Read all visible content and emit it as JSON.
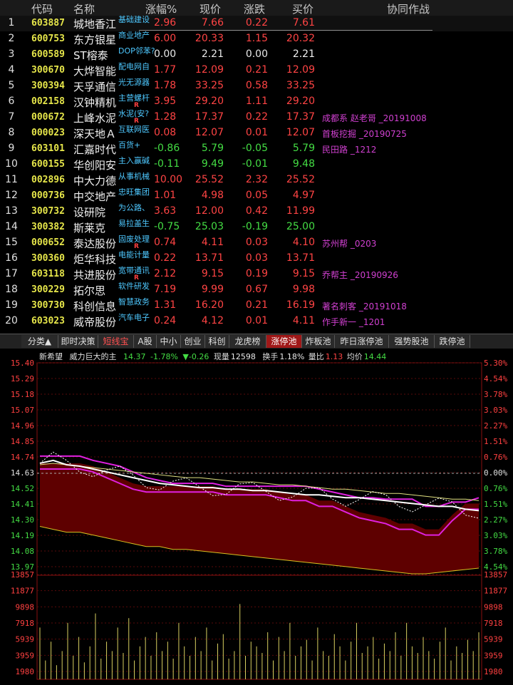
{
  "headers": {
    "idx": "",
    "code": "代码",
    "name": "名称",
    "pct": "涨幅%",
    "price": "现价",
    "chg": "涨跌",
    "bid": "买价",
    "note": "协同作战"
  },
  "rows": [
    {
      "idx": "1",
      "code": "603887",
      "name": "城地香江",
      "ind": "基础建设",
      "r": "",
      "pct": "2.96",
      "price": "7.66",
      "chg": "0.22",
      "bid": "7.61",
      "note": "",
      "dir": "up"
    },
    {
      "idx": "2",
      "code": "600753",
      "name": "东方银星",
      "ind": "商业地产",
      "r": "",
      "pct": "6.00",
      "price": "20.33",
      "chg": "1.15",
      "bid": "20.32",
      "note": "",
      "dir": "up"
    },
    {
      "idx": "3",
      "code": "600589",
      "name": "ST榕泰",
      "ind": "DOP邻苯?",
      "r": "",
      "pct": "0.00",
      "price": "2.21",
      "chg": "0.00",
      "bid": "2.21",
      "note": "",
      "dir": "eq"
    },
    {
      "idx": "4",
      "code": "300670",
      "name": "大烨智能",
      "ind": "配电网自",
      "r": "",
      "pct": "1.77",
      "price": "12.09",
      "chg": "0.21",
      "bid": "12.09",
      "note": "",
      "dir": "up"
    },
    {
      "idx": "5",
      "code": "300394",
      "name": "天孚通信",
      "ind": "光无源器",
      "r": "",
      "pct": "1.78",
      "price": "33.25",
      "chg": "0.58",
      "bid": "33.25",
      "note": "",
      "dir": "up"
    },
    {
      "idx": "6",
      "code": "002158",
      "name": "汉钟精机",
      "ind": "主营螺杆",
      "r": "R",
      "pct": "3.95",
      "price": "29.20",
      "chg": "1.11",
      "bid": "29.20",
      "note": "",
      "dir": "up"
    },
    {
      "idx": "7",
      "code": "000672",
      "name": "上峰水泥",
      "ind": "水泥(安?",
      "r": "R",
      "pct": "1.28",
      "price": "17.37",
      "chg": "0.22",
      "bid": "17.37",
      "note": "成都系  赵老哥  _20191008",
      "dir": "up"
    },
    {
      "idx": "8",
      "code": "000023",
      "name": "深天地Ａ",
      "ind": "互联网医",
      "r": "",
      "pct": "0.08",
      "price": "12.07",
      "chg": "0.01",
      "bid": "12.07",
      "note": "首板挖掘  _20190725",
      "dir": "up"
    },
    {
      "idx": "9",
      "code": "603101",
      "name": "汇嘉时代",
      "ind": "百货+",
      "r": "",
      "pct": "-0.86",
      "price": "5.79",
      "chg": "-0.05",
      "bid": "5.79",
      "note": "民田路  _1212",
      "dir": "dn"
    },
    {
      "idx": "10",
      "code": "600155",
      "name": "华创阳安",
      "ind": "主入赢碱",
      "r": "",
      "pct": "-0.11",
      "price": "9.49",
      "chg": "-0.01",
      "bid": "9.48",
      "note": "",
      "dir": "dn"
    },
    {
      "idx": "11",
      "code": "002896",
      "name": "中大力德",
      "ind": "从事机械",
      "r": "",
      "pct": "10.00",
      "price": "25.52",
      "chg": "2.32",
      "bid": "25.52",
      "note": "",
      "dir": "up"
    },
    {
      "idx": "12",
      "code": "000736",
      "name": "中交地产",
      "ind": "忠旺集团",
      "r": "",
      "pct": "1.01",
      "price": "4.98",
      "chg": "0.05",
      "bid": "4.97",
      "note": "",
      "dir": "up"
    },
    {
      "idx": "13",
      "code": "300732",
      "name": "设研院",
      "ind": "为公路、",
      "r": "",
      "pct": "3.63",
      "price": "12.00",
      "chg": "0.42",
      "bid": "11.99",
      "note": "",
      "dir": "up"
    },
    {
      "idx": "14",
      "code": "300382",
      "name": "斯莱克",
      "ind": "易拉盖生",
      "r": "",
      "pct": "-0.75",
      "price": "25.03",
      "chg": "-0.19",
      "bid": "25.00",
      "note": "",
      "dir": "dn"
    },
    {
      "idx": "15",
      "code": "000652",
      "name": "泰达股份",
      "ind": "固废处理",
      "r": "R",
      "pct": "0.74",
      "price": "4.11",
      "chg": "0.03",
      "bid": "4.10",
      "note": "苏州帮  _0203",
      "dir": "up"
    },
    {
      "idx": "16",
      "code": "300360",
      "name": "炬华科技",
      "ind": "电能计量",
      "r": "",
      "pct": "0.22",
      "price": "13.71",
      "chg": "0.03",
      "bid": "13.71",
      "note": "",
      "dir": "up"
    },
    {
      "idx": "17",
      "code": "603118",
      "name": "共进股份",
      "ind": "宽带通讯",
      "r": "R",
      "pct": "2.12",
      "price": "9.15",
      "chg": "0.19",
      "bid": "9.15",
      "note": "乔帮主  _20190926",
      "dir": "up"
    },
    {
      "idx": "18",
      "code": "300229",
      "name": "拓尔思",
      "ind": "软件研发",
      "r": "",
      "pct": "7.19",
      "price": "9.99",
      "chg": "0.67",
      "bid": "9.98",
      "note": "",
      "dir": "up"
    },
    {
      "idx": "19",
      "code": "300730",
      "name": "科创信息",
      "ind": "智慧政务",
      "r": "",
      "pct": "1.31",
      "price": "16.20",
      "chg": "0.21",
      "bid": "16.19",
      "note": "著名刺客  _20191018",
      "dir": "up"
    },
    {
      "idx": "20",
      "code": "603023",
      "name": "威帝股份",
      "ind": "汽车电子",
      "r": "",
      "pct": "0.24",
      "price": "4.12",
      "chg": "0.01",
      "bid": "4.11",
      "note": "作手新一  _1201",
      "dir": "up"
    }
  ],
  "tabs": [
    {
      "label": "分类▲",
      "on": false,
      "red": false
    },
    {
      "label": "即时决策",
      "on": false,
      "red": false
    },
    {
      "label": "短线宝",
      "on": false,
      "red": true
    },
    {
      "label": "A股",
      "on": false,
      "red": false
    },
    {
      "label": "中小",
      "on": false,
      "red": false
    },
    {
      "label": "创业",
      "on": false,
      "red": false
    },
    {
      "label": "科创",
      "on": false,
      "red": false
    },
    {
      "label": "龙虎榜",
      "on": false,
      "red": false
    },
    {
      "label": "涨停池",
      "on": true,
      "red": false
    },
    {
      "label": "炸板池",
      "on": false,
      "red": false
    },
    {
      "label": "昨日涨停池",
      "on": false,
      "red": false
    },
    {
      "label": "强势股池",
      "on": false,
      "red": false
    },
    {
      "label": "跌停池",
      "on": false,
      "red": false
    }
  ],
  "info": {
    "stock": "新希望",
    "label": "威力巨大的主",
    "price": "14.37",
    "pct": "-1.78%",
    "chg": "▼-0.26",
    "vol_label": "现量",
    "vol": "12598",
    "turnover_label": "换手",
    "turnover": "1.18%",
    "ratio_label": "量比",
    "ratio": "1.13",
    "avg_label": "均价",
    "avg": "14.44"
  },
  "chart_data": {
    "type": "line",
    "price_axis": [
      "15.40",
      "15.29",
      "15.18",
      "15.07",
      "14.96",
      "14.85",
      "14.74",
      "14.63",
      "14.52",
      "14.41",
      "14.30",
      "14.19",
      "14.08",
      "13.97"
    ],
    "pct_axis": [
      "5.30%",
      "4.54%",
      "3.78%",
      "3.03%",
      "2.27%",
      "1.51%",
      "0.76%",
      "0.00%",
      "0.76%",
      "1.51%",
      "2.27%",
      "3.03%",
      "3.78%",
      "4.54%"
    ],
    "volume_axis": [
      "13857",
      "11877",
      "9898",
      "7918",
      "5939",
      "3959",
      "1980"
    ],
    "prev_close": 14.63,
    "ylim": [
      13.93,
      15.4
    ],
    "series": [
      {
        "name": "price",
        "color": "#ffffff",
        "values": [
          14.7,
          14.72,
          14.69,
          14.68,
          14.66,
          14.64,
          14.62,
          14.6,
          14.58,
          14.56,
          14.55,
          14.54,
          14.53,
          14.53,
          14.52,
          14.52,
          14.51,
          14.51,
          14.5,
          14.49,
          14.48,
          14.48,
          14.47,
          14.46,
          14.46,
          14.45,
          14.44,
          14.43,
          14.42,
          14.41,
          14.4,
          14.4,
          14.38,
          14.37
        ]
      },
      {
        "name": "avg",
        "color": "#ffff66",
        "values": [
          14.69,
          14.7,
          14.69,
          14.68,
          14.67,
          14.66,
          14.65,
          14.64,
          14.63,
          14.62,
          14.61,
          14.6,
          14.6,
          14.59,
          14.58,
          14.57,
          14.57,
          14.56,
          14.55,
          14.55,
          14.54,
          14.53,
          14.52,
          14.52,
          14.51,
          14.5,
          14.49,
          14.49,
          14.48,
          14.47,
          14.46,
          14.45,
          14.45,
          14.44
        ]
      },
      {
        "name": "band_up",
        "color": "#e020e0",
        "values": [
          14.75,
          14.75,
          14.75,
          14.75,
          14.72,
          14.7,
          14.68,
          14.64,
          14.6,
          14.58,
          14.56,
          14.56,
          14.56,
          14.56,
          14.54,
          14.54,
          14.54,
          14.54,
          14.54,
          14.54,
          14.54,
          14.52,
          14.5,
          14.48,
          14.46,
          14.46,
          14.45,
          14.45,
          14.45,
          14.4,
          14.4,
          14.43,
          14.43,
          14.46
        ]
      },
      {
        "name": "band_low",
        "color": "#e020e0",
        "values": [
          14.66,
          14.66,
          14.66,
          14.66,
          14.64,
          14.6,
          14.56,
          14.52,
          14.5,
          14.5,
          14.5,
          14.5,
          14.5,
          14.5,
          14.48,
          14.48,
          14.48,
          14.48,
          14.46,
          14.44,
          14.44,
          14.4,
          14.4,
          14.36,
          14.32,
          14.3,
          14.28,
          14.24,
          14.24,
          14.2,
          14.2,
          14.3,
          14.38,
          14.38
        ]
      },
      {
        "name": "fill_low",
        "color": "#6a0000",
        "values": [
          14.26,
          14.24,
          14.22,
          14.22,
          14.2,
          14.18,
          14.16,
          14.14,
          14.12,
          14.12,
          14.1,
          14.1,
          14.09,
          14.08,
          14.07,
          14.06,
          14.05,
          14.04,
          14.03,
          14.02,
          14.01,
          14.0,
          13.99,
          13.98,
          13.97,
          13.96,
          13.95,
          13.94,
          13.93,
          13.93,
          13.94,
          13.95,
          13.96,
          13.97
        ]
      }
    ],
    "volume": [
      55,
      20,
      40,
      15,
      30,
      60,
      25,
      45,
      18,
      35,
      70,
      22,
      40,
      30,
      55,
      28,
      65,
      20,
      35,
      45,
      25,
      50,
      30,
      40,
      22,
      60,
      35,
      25,
      45,
      30,
      55,
      20,
      38,
      48,
      22,
      30,
      80,
      25,
      40,
      35,
      28,
      50,
      20,
      45,
      30,
      60,
      25,
      35,
      42,
      20,
      55,
      30,
      25,
      48,
      35,
      20,
      40,
      60,
      28,
      35,
      45,
      22,
      38,
      30,
      50,
      25,
      60,
      35,
      28,
      45,
      30,
      22,
      40,
      55,
      20,
      35,
      28,
      42,
      30,
      50
    ]
  }
}
